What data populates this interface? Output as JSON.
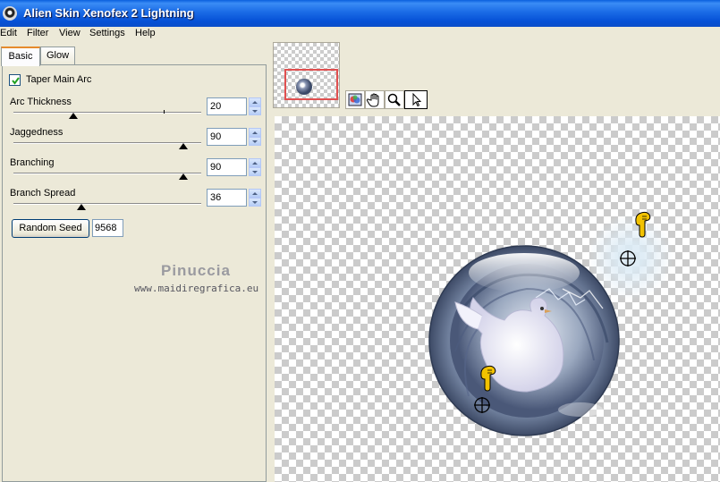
{
  "window": {
    "title": "Alien Skin Xenofex 2 Lightning"
  },
  "menu": [
    "Edit",
    "Filter",
    "View",
    "Settings",
    "Help"
  ],
  "tabs": [
    {
      "label": "Basic",
      "active": true
    },
    {
      "label": "Glow",
      "active": false
    }
  ],
  "basic": {
    "taper_main_arc": {
      "label": "Taper Main Arc",
      "checked": true
    },
    "controls": [
      {
        "label": "Arc Thickness",
        "value": "20"
      },
      {
        "label": "Jaggedness",
        "value": "90"
      },
      {
        "label": "Branching",
        "value": "90"
      },
      {
        "label": "Branch Spread",
        "value": "36"
      }
    ],
    "random_seed": {
      "label": "Random Seed",
      "value": "9568"
    }
  },
  "watermark": {
    "name": "Pinuccia",
    "url": "www.maidiregrafica.eu"
  },
  "toolbar": {
    "tools": [
      "preview-toggle-icon",
      "hand-icon",
      "zoom-icon",
      "arrow-pointer-icon"
    ],
    "active_tool": "arrow-pointer-icon"
  },
  "colors": {
    "titlebar": "#0a5fde",
    "panel": "#ece9d8",
    "preview_frame": "#e05050",
    "pointer_hand": "#f2c200"
  }
}
